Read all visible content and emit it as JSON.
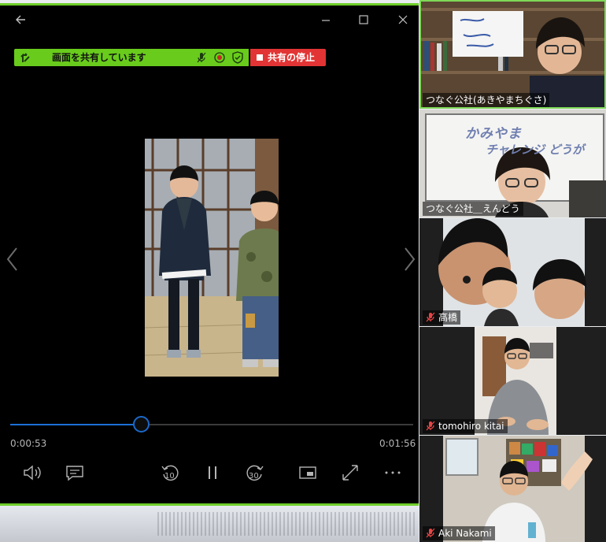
{
  "share": {
    "text": "画面を共有しています",
    "stop_label": "共有の停止"
  },
  "player": {
    "current_time": "0:00:53",
    "total_time": "0:01:56",
    "progress": 0.325,
    "skip_back_seconds": "10",
    "skip_forward_seconds": "30"
  },
  "whiteboard": {
    "line1": "かみやま",
    "line2": "チャレンジ どうが"
  },
  "participants": [
    {
      "name": "つなぐ公社(あきやまちぐさ)",
      "muted": false,
      "active": true
    },
    {
      "name": "つなぐ公社＿えんどう",
      "muted": false,
      "active": false
    },
    {
      "name": "高橋",
      "muted": true,
      "active": false
    },
    {
      "name": "tomohiro kitai",
      "muted": true,
      "active": false
    },
    {
      "name": "Aki Nakami",
      "muted": true,
      "active": false
    }
  ],
  "colors": {
    "share_green": "#69cc1c",
    "stop_red": "#e23434",
    "active_speaker": "#7ed957",
    "timeline_blue": "#1c6fd6"
  }
}
